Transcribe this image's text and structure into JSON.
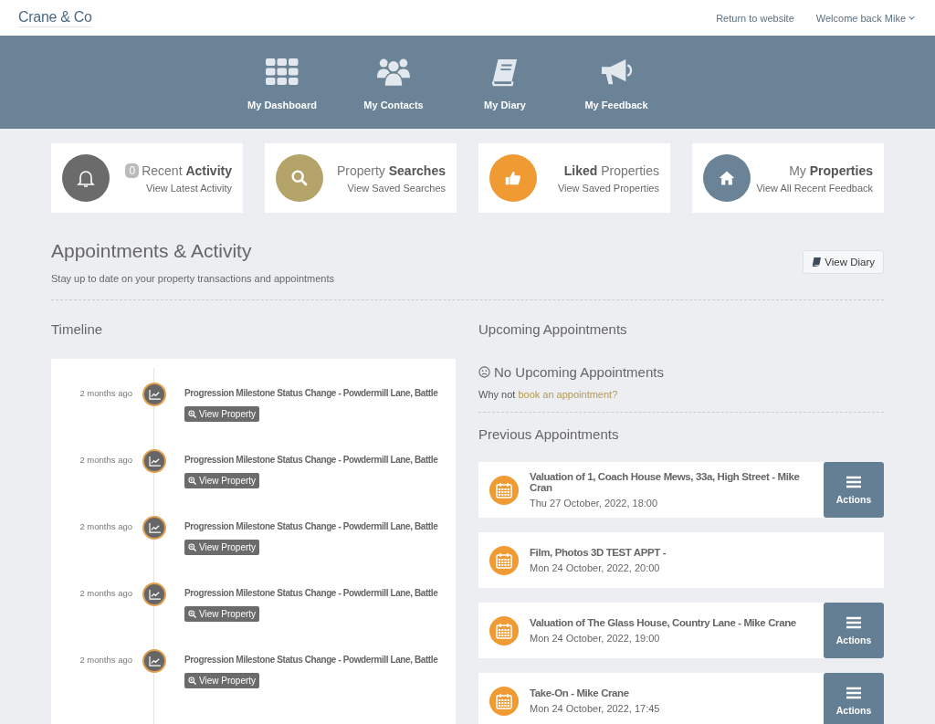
{
  "header": {
    "logo": "Crane & Co",
    "links": [
      "Return to website"
    ],
    "user_menu": "Welcome back Mike"
  },
  "nav": [
    {
      "label": "My Dashboard",
      "kind": "grid"
    },
    {
      "label": "My Contacts",
      "kind": "people"
    },
    {
      "label": "My Diary",
      "kind": "book"
    },
    {
      "label": "My Feedback",
      "kind": "megaphone"
    }
  ],
  "stat_cards": [
    {
      "badge": "0",
      "title": "Recent **Activity**",
      "subtitle": "View Latest Activity",
      "kind": "bell",
      "color": "#6b6b6b"
    },
    {
      "title": "Property **Searches**",
      "subtitle": "View Saved Searches",
      "kind": "search",
      "color": "#b5a46a"
    },
    {
      "title": "**Liked** Properties",
      "subtitle": "View Saved Properties",
      "kind": "thumb",
      "color": "#f09a33"
    },
    {
      "title": "My **Properties**",
      "subtitle": "View All Recent Feedback",
      "kind": "home",
      "color": "#6a8396"
    }
  ],
  "section": {
    "title": "Appointments & Activity",
    "subtitle": "Stay up to date on your property transactions and appointments",
    "button": "View Diary"
  },
  "timeline": {
    "title": "Timeline",
    "items": [
      {
        "time": "2 months ago",
        "title": "Progression Milestone Status Change - Powdermill Lane, Battle",
        "button": "View Property"
      },
      {
        "time": "2 months ago",
        "title": "Progression Milestone Status Change - Powdermill Lane, Battle",
        "button": "View Property"
      },
      {
        "time": "2 months ago",
        "title": "Progression Milestone Status Change - Powdermill Lane, Battle",
        "button": "View Property"
      },
      {
        "time": "2 months ago",
        "title": "Progression Milestone Status Change - Powdermill Lane, Battle",
        "button": "View Property"
      },
      {
        "time": "2 months ago",
        "title": "Progression Milestone Status Change - Powdermill Lane, Battle",
        "button": "View Property"
      }
    ]
  },
  "upcoming": {
    "title": "Upcoming Appointments",
    "empty": "No Upcoming Appointments",
    "prompt": "Why not",
    "link": "book an appointment?"
  },
  "previous": {
    "title": "Previous Appointments",
    "items": [
      {
        "title": "Valuation of 1, Coach House Mews, 33a, High Street - Mike Cran",
        "date": "Thu 27 October, 2022, 18:00",
        "actions": "Actions"
      },
      {
        "title": "Film, Photos 3D TEST APPT -",
        "date": "Mon 24 October, 2022, 20:00"
      },
      {
        "title": "Valuation of The Glass House, Country Lane - Mike Crane",
        "date": "Mon 24 October, 2022, 19:00",
        "actions": "Actions"
      },
      {
        "title": "Take-On - Mike Crane",
        "date": "Mon 24 October, 2022, 17:45",
        "actions": "Actions"
      }
    ]
  }
}
